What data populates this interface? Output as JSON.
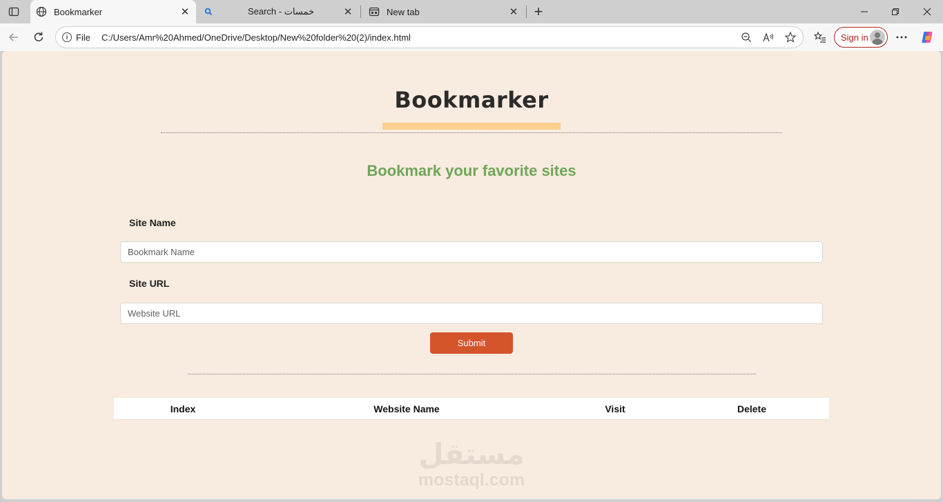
{
  "browser": {
    "tabs": [
      {
        "title": "Bookmarker",
        "icon": "globe-icon",
        "active": true
      },
      {
        "title": "Search - خمسات",
        "icon": "search-icon",
        "active": false
      },
      {
        "title": "New tab",
        "icon": "newtab-icon",
        "active": false
      }
    ],
    "address": {
      "scheme_label": "File",
      "url": "C:/Users/Amr%20Ahmed/OneDrive/Desktop/New%20folder%20(2)/index.html"
    },
    "signin_label": "Sign in",
    "colors": {
      "signin_accent": "#b42318",
      "frame": "#cfcfcf"
    }
  },
  "page": {
    "title": "Bookmarker",
    "subtitle": "Bookmark your favorite sites",
    "form": {
      "site_name_label": "Site Name",
      "site_name_placeholder": "Bookmark Name",
      "site_url_label": "Site URL",
      "site_url_placeholder": "Website URL",
      "submit_label": "Submit"
    },
    "table": {
      "headers": [
        "Index",
        "Website Name",
        "Visit",
        "Delete"
      ],
      "rows": []
    },
    "watermark": {
      "arabic": "مستقل",
      "latin": "mostaql.com"
    },
    "colors": {
      "background": "#f8ebdf",
      "title_underline": "#fbcf8e",
      "subtitle": "#6fa65a",
      "submit": "#d4542c"
    }
  }
}
